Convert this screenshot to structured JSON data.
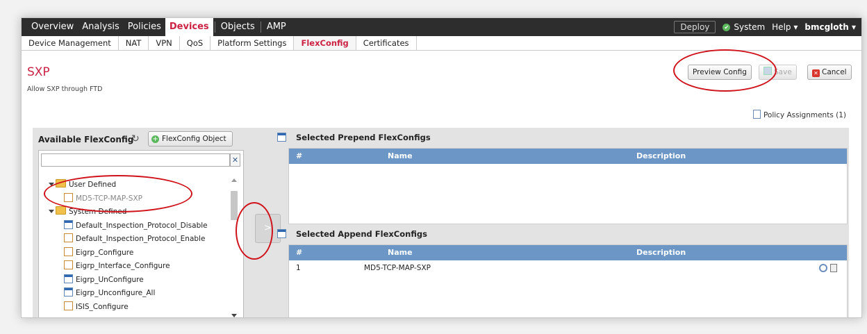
{
  "topnav": {
    "items": [
      "Overview",
      "Analysis",
      "Policies",
      "Devices",
      "Objects",
      "AMP"
    ],
    "active": "Devices",
    "deploy": "Deploy",
    "system": "System",
    "help": "Help ▾",
    "user": "bmcgloth ▾"
  },
  "subnav": {
    "items": [
      "Device Management",
      "NAT",
      "VPN",
      "QoS",
      "Platform Settings",
      "FlexConfig",
      "Certificates"
    ],
    "active": "FlexConfig"
  },
  "page": {
    "title": "SXP",
    "subtitle": "Allow SXP through FTD"
  },
  "actions": {
    "preview": "Preview Config",
    "save": "Save",
    "cancel": "Cancel"
  },
  "policy_assignments": "Policy Assignments (1)",
  "left_panel": {
    "header": "Available FlexConfig",
    "add_button": "FlexConfig Object",
    "search_placeholder": "",
    "tree": [
      {
        "label": "User Defined",
        "type": "folder",
        "level": 0
      },
      {
        "label": "MD5-TCP-MAP-SXP",
        "type": "orange",
        "level": 1,
        "muted": true
      },
      {
        "label": "System Defined",
        "type": "folder",
        "level": 0
      },
      {
        "label": "Default_Inspection_Protocol_Disable",
        "type": "blue",
        "level": 1
      },
      {
        "label": "Default_Inspection_Protocol_Enable",
        "type": "orange",
        "level": 1
      },
      {
        "label": "Eigrp_Configure",
        "type": "orange",
        "level": 1
      },
      {
        "label": "Eigrp_Interface_Configure",
        "type": "orange",
        "level": 1
      },
      {
        "label": "Eigrp_UnConfigure",
        "type": "blue",
        "level": 1
      },
      {
        "label": "Eigrp_Unconfigure_All",
        "type": "blue",
        "level": 1
      },
      {
        "label": "ISIS_Configure",
        "type": "orange",
        "level": 1
      }
    ]
  },
  "move_button": ">",
  "prepend": {
    "header": "Selected Prepend FlexConfigs",
    "columns": [
      "#",
      "Name",
      "Description"
    ],
    "rows": []
  },
  "append": {
    "header": "Selected Append FlexConfigs",
    "columns": [
      "#",
      "Name",
      "Description"
    ],
    "rows": [
      {
        "num": "1",
        "name": "MD5-TCP-MAP-SXP",
        "description": ""
      }
    ]
  },
  "colors": {
    "accent": "#cc2244",
    "nav_bg": "#2d2d2d",
    "grid_header": "#6b96c6",
    "annotation": "#d0121b"
  }
}
